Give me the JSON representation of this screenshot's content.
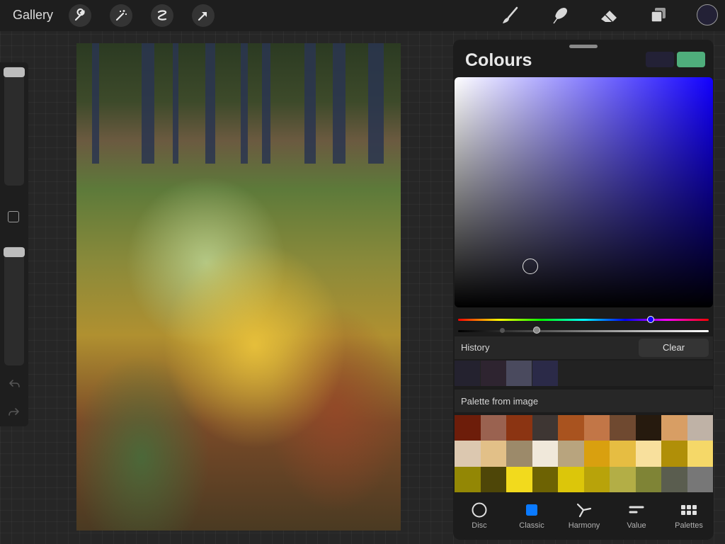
{
  "toolbar": {
    "gallery_label": "Gallery",
    "left_tools": [
      "wrench-icon",
      "magic-wand-icon",
      "selection-icon",
      "transform-arrow-icon"
    ],
    "right_tools": [
      "brush-icon",
      "smudge-icon",
      "eraser-icon",
      "layers-icon"
    ],
    "current_color": "#232136"
  },
  "colours_panel": {
    "title": "Colours",
    "secondary_color": "#232136",
    "primary_color": "#4fae7c",
    "active_mode": "Classic",
    "hue_color": "#1200ff",
    "history": {
      "label": "History",
      "clear_label": "Clear",
      "swatches": [
        "#24222f",
        "#2e2430",
        "#4a4a5e",
        "#2b2a48"
      ]
    },
    "palette": {
      "label": "Palette from image",
      "swatches": [
        "#6d1d0a",
        "#9a6250",
        "#8b3412",
        "#3e3633",
        "#a9531f",
        "#c27647",
        "#6f4930",
        "#261a0e",
        "#d89e64",
        "#bfb2a6",
        "#dcc8b0",
        "#e2c088",
        "#9c8a6a",
        "#f0e8da",
        "#b8a47e",
        "#d9a00f",
        "#e6bd42",
        "#f8e09d",
        "#b08f08",
        "#f5d868",
        "#938705",
        "#4e4608",
        "#f2da1d",
        "#6d6203",
        "#dcc60a",
        "#b8a30a",
        "#b3ae46",
        "#7f8436",
        "#5a5d4f",
        "#777777"
      ]
    },
    "tabs": [
      {
        "label": "Disc",
        "icon": "disc-icon"
      },
      {
        "label": "Classic",
        "icon": "classic-square-icon"
      },
      {
        "label": "Harmony",
        "icon": "harmony-icon"
      },
      {
        "label": "Value",
        "icon": "value-sliders-icon"
      },
      {
        "label": "Palettes",
        "icon": "palettes-grid-icon"
      }
    ]
  }
}
